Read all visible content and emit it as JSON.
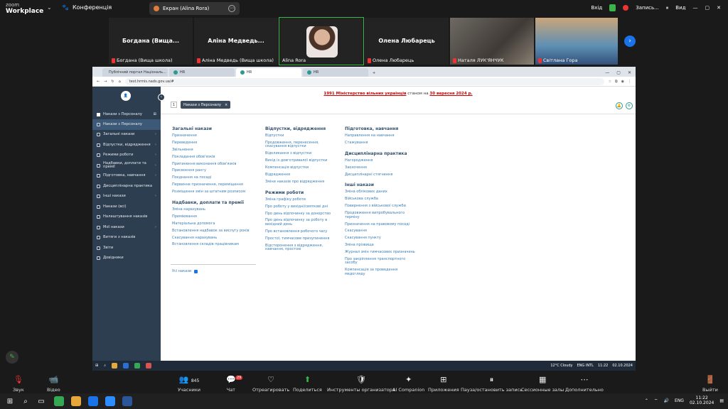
{
  "zoom_top": {
    "brand_line1": "zoom",
    "brand_line2": "Workplace",
    "conference_label": "Конференція",
    "screen_share_label": "Екран (Alina Rora)",
    "enter_label": "Вхід",
    "record_label": "Запись...",
    "view_label": "Вид"
  },
  "gallery": {
    "tiles": [
      {
        "big": "Богдана (Вища...",
        "small": "Богдана (Вища школа)"
      },
      {
        "big": "Аліна Медведь...",
        "small": "Аліна Медведь (Вища школа)"
      },
      {
        "big": "",
        "small": "Alina Rora"
      },
      {
        "big": "Олена Любарець",
        "small": "Олена Любарець"
      },
      {
        "big": "",
        "small": "Наталя ЛУК'ЯНЧУК"
      },
      {
        "big": "",
        "small": "Світлана Гора"
      }
    ]
  },
  "browser": {
    "tabs": [
      "Публічний портал Національ...",
      "HR",
      "HR",
      "HR"
    ],
    "new_tab": "+",
    "url": "test.hrmis.nads.gov.ua/#"
  },
  "sidebar": {
    "avatar": "👤",
    "section_title": "Накази з Персоналу",
    "collapse": "‹",
    "items": [
      {
        "label": "Накази з Персоналу",
        "arrow": ""
      },
      {
        "label": "Загальні накази",
        "arrow": "›"
      },
      {
        "label": "Відпустки, відрядження",
        "arrow": "›"
      },
      {
        "label": "Режими роботи",
        "arrow": "›"
      },
      {
        "label": "Надбавки, доплати та премії",
        "arrow": "›"
      },
      {
        "label": "Підготовка, навчання",
        "arrow": "›"
      },
      {
        "label": "Дисциплінарна практика",
        "arrow": ""
      },
      {
        "label": "Інші накази",
        "arrow": "›"
      },
      {
        "label": "Накази (всі)",
        "arrow": ""
      },
      {
        "label": "Налаштування наказів",
        "arrow": ""
      },
      {
        "label": "Мої накази",
        "arrow": "›"
      },
      {
        "label": "Витяги з наказів",
        "arrow": ""
      },
      {
        "label": "Звіти",
        "arrow": ""
      },
      {
        "label": "Довідники",
        "arrow": ""
      }
    ]
  },
  "banner": {
    "part1": "1991 Міністерство вільних українців",
    "part2": " станом на ",
    "part3": "30 вересня 2024 р."
  },
  "chips": {
    "number": "1",
    "chip_label": "Накази з Персоналу",
    "chip_close": "×"
  },
  "columns": {
    "general": {
      "title": "Загальні накази",
      "links": [
        "Призначення",
        "Переведення",
        "Звільнення",
        "Покладання обов'язків",
        "Припинення виконання обов'язків",
        "Присвоєння рангу",
        "Поєднання на посаді",
        "Первинне призначення, переміщення",
        "Розміщення змін за штатним розписом"
      ]
    },
    "bonuses": {
      "title": "Надбавки, доплати та премії",
      "links": [
        "Зміна нарахувань",
        "Преміювання",
        "Матеріальна допомога",
        "Встановлення надбавок за вислугу років",
        "Скасування нарахувань",
        "Встановлення складів працівникам"
      ]
    },
    "vacations": {
      "title": "Відпустки, відрядження",
      "links": [
        "Відпустки",
        "Продовження, перенесення, скасування відпустки",
        "Відкликання з відпустки",
        "Вихід із довготривалої відпустки",
        "Компенсація відпустки",
        "Відрядження",
        "Зміни наказів про відрядження"
      ]
    },
    "modes": {
      "title": "Режими роботи",
      "links": [
        "Зміна графіку роботи",
        "Про роботу у вихідні/святкові дні",
        "Про день відпочинку за донорство",
        "Про день відпочинку за роботу в вихідний день",
        "Про встановлення робочого часу",
        "Простої, тимчасове призупинення",
        "Відсторонення з відрядження, навчання, простою"
      ]
    },
    "training": {
      "title": "Підготовка, навчання",
      "links": [
        "Направлення на навчання",
        "Стажування"
      ]
    },
    "discipline": {
      "title": "Дисциплінарна практика",
      "links": [
        "Нагородження",
        "Заохочення",
        "Дисциплінарні стягнення"
      ]
    },
    "other": {
      "title": "Інші накази",
      "links": [
        "Зміна облікових даних",
        "Військова служба",
        "Повернення з військової служби",
        "Продовження випробувального терміну",
        "Призначення на правовому посаді",
        "Скасування",
        "Скасування пункту",
        "Зміна прізвища",
        "Журнал змін тимчасових призначень",
        "Про закріплення транспортного засобу",
        "Компенсація за проведення медогляду"
      ]
    }
  },
  "all_orders_label": "Усі накази",
  "win_taskbar": {
    "weather": "12°C Cloudy",
    "lang": "ENG INTL",
    "time": "11:22",
    "date": "02.10.2024"
  },
  "zoom_bottom": {
    "buttons": [
      {
        "icon": "🎙",
        "label": "Звук"
      },
      {
        "icon": "📹",
        "label": "Відео"
      },
      {
        "icon": "👥",
        "label": "Учасники",
        "count": "845"
      },
      {
        "icon": "💬",
        "label": "Чат",
        "badge": "29"
      },
      {
        "icon": "♡",
        "label": "Отреагировать"
      },
      {
        "icon": "⬆",
        "label": "Поделиться"
      },
      {
        "icon": "🛡",
        "label": "Инструменты организатора"
      },
      {
        "icon": "✦",
        "label": "AI Companion"
      },
      {
        "icon": "⊞",
        "label": "Приложения"
      },
      {
        "icon": "⏸",
        "label": "Пауза/остановить запись"
      },
      {
        "icon": "▦",
        "label": "Сессионные залы"
      },
      {
        "icon": "⋯",
        "label": "Дополнительно"
      },
      {
        "icon": "🚪",
        "label": "Выйти"
      }
    ]
  },
  "os_taskbar": {
    "lang": "ENG",
    "time": "11:22",
    "date": "02.10.2024"
  },
  "colors": {
    "sidebar_bg": "#2d3e50",
    "link": "#3a7db4",
    "heading": "#33506b",
    "banner_red": "#cc0000",
    "zoom_bg": "#1a1a1a",
    "accent_green": "#3bb54a"
  }
}
